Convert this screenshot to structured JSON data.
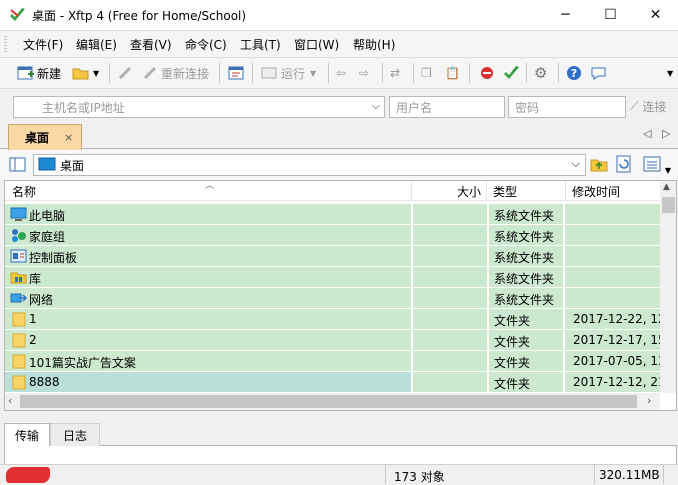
{
  "window": {
    "title": "桌面 - Xftp 4 (Free for Home/School)",
    "controls": {
      "minimize": "─",
      "maximize": "☐",
      "close": "✕"
    }
  },
  "menu": [
    "文件(F)",
    "编辑(E)",
    "查看(V)",
    "命令(C)",
    "工具(T)",
    "窗口(W)",
    "帮助(H)"
  ],
  "toolbar": {
    "new_label": "新建",
    "reconnect_label": "重新连接",
    "run_label": "运行"
  },
  "address": {
    "host_placeholder": "主机名或IP地址",
    "user_placeholder": "用户名",
    "password_placeholder": "密码",
    "connect_label": "连接"
  },
  "tabs": [
    {
      "label": "桌面",
      "close": "×"
    }
  ],
  "tab_nav": {
    "prev": "◁",
    "next": "▷"
  },
  "path": {
    "current": "桌面"
  },
  "columns": {
    "name": "名称",
    "size": "大小",
    "type": "类型",
    "modified": "修改时间"
  },
  "files": [
    {
      "name": "此电脑",
      "type": "系统文件夹",
      "modified": "",
      "icon": "computer-icon"
    },
    {
      "name": "家庭组",
      "type": "系统文件夹",
      "modified": "",
      "icon": "homegroup-icon"
    },
    {
      "name": "控制面板",
      "type": "系统文件夹",
      "modified": "",
      "icon": "control-panel-icon"
    },
    {
      "name": "库",
      "type": "系统文件夹",
      "modified": "",
      "icon": "library-icon"
    },
    {
      "name": "网络",
      "type": "系统文件夹",
      "modified": "",
      "icon": "network-icon"
    },
    {
      "name": "1",
      "type": "文件夹",
      "modified": "2017-12-22, 12",
      "icon": "folder-icon"
    },
    {
      "name": "2",
      "type": "文件夹",
      "modified": "2017-12-17, 15",
      "icon": "folder-icon"
    },
    {
      "name": "101篇实战广告文案",
      "type": "文件夹",
      "modified": "2017-07-05, 13",
      "icon": "folder-icon"
    },
    {
      "name": "8888",
      "type": "文件夹",
      "modified": "2017-12-12, 21",
      "icon": "folder-icon"
    }
  ],
  "bottom_tabs": [
    "传输",
    "日志"
  ],
  "status": {
    "count": "173 对象",
    "size": "320.11MB"
  },
  "colors": {
    "row_bg": "#cce8cf",
    "selected_bg": "#b9e0d8",
    "tab_active": "#f9d8a3"
  }
}
